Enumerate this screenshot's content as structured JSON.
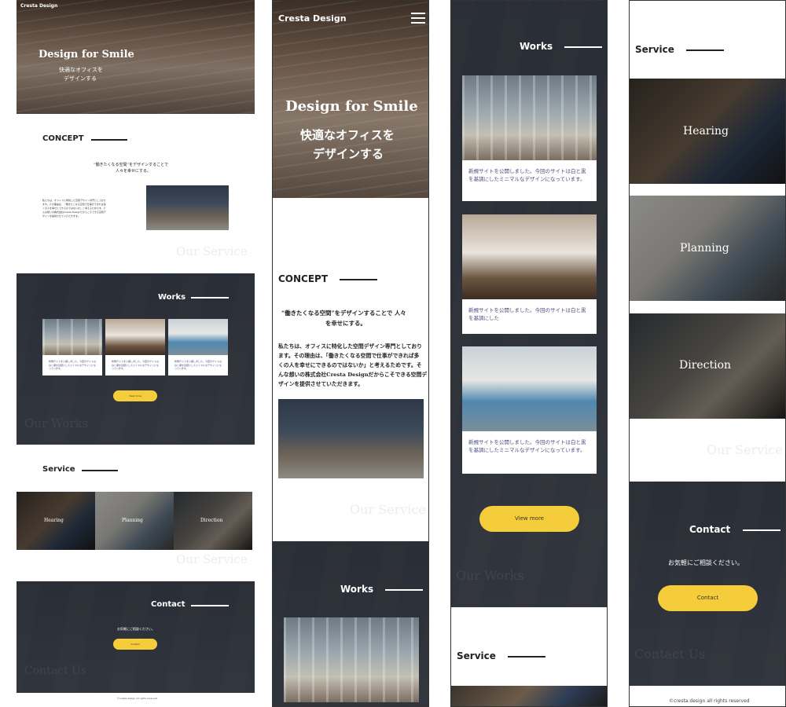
{
  "colors": {
    "accent": "#f5cd3b",
    "dark": "#2e3138",
    "text": "#222222",
    "caption": "#4b4b80"
  },
  "brand": "Cresta Design",
  "hero": {
    "title": "Design for Smile",
    "sub1": "快適なオフィスを",
    "sub2": "デザインする"
  },
  "concept": {
    "heading": "CONCEPT",
    "lead1": "“働きたくなる空間”をデザインすることで",
    "lead2": "人々を幸せにする。",
    "lead_mobile1": "“働きたくなる空間”をデザインすることで 人々",
    "lead_mobile2": "を幸せにする。",
    "body": [
      "私たちは、オフィスに特化した空間デザイン専門としており",
      "ます。その理由は、「働きたくなる空間で仕事ができれば多",
      "くの人を幸せにできるのではないか」と考えるためです。そ",
      "んな想いの株式会社Cresta Designだからこそできる空間デ",
      "ザインを提供させていただきます。"
    ]
  },
  "ghost": {
    "service": "Our Service",
    "works": "Our Works",
    "contact": "Contact Us"
  },
  "works": {
    "heading": "Works",
    "captions": [
      "新規サイトを公開しました。今回のサイトは白と黒を基調にしたミニマルなデザインになっています。",
      "新規サイトを公開しました。今回のサイトは白と黒を基調にした",
      "新規サイトを公開しました。今回のサイトは白と黒を基調にしたミニマルなデザインになっています。"
    ],
    "button": "View more"
  },
  "service": {
    "heading": "Service",
    "items": [
      {
        "label": "Hearing"
      },
      {
        "label": "Planning"
      },
      {
        "label": "Direction"
      }
    ]
  },
  "contact": {
    "heading": "Contact",
    "text": "お気軽にご相談ください。",
    "button": "Contact"
  },
  "footer": {
    "copyright": "©cresta.design all rights reserved"
  }
}
